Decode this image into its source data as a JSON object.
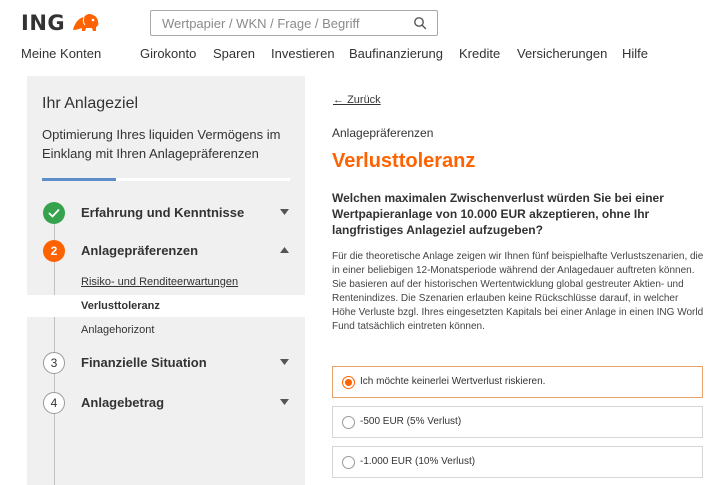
{
  "header": {
    "logo_text": "ING",
    "logo_icon": "lion-icon",
    "search_placeholder": "Wertpapier / WKN / Frage / Begriff",
    "search_value": ""
  },
  "nav": {
    "items": [
      {
        "label": "Meine Konten"
      },
      {
        "label": "Girokonto"
      },
      {
        "label": "Sparen"
      },
      {
        "label": "Investieren"
      },
      {
        "label": "Baufinanzierung"
      },
      {
        "label": "Kredite"
      },
      {
        "label": "Versicherungen"
      },
      {
        "label": "Hilfe"
      }
    ]
  },
  "sidebar": {
    "title": "Ihr Anlageziel",
    "subtitle": "Optimierung Ihres liquiden Vermögens im Einklang mit Ihren Anlagepräferenzen",
    "progress_fraction": 0.3,
    "steps": [
      {
        "number": "",
        "label": "Erfahrung und Kenntnisse",
        "status": "done"
      },
      {
        "number": "2",
        "label": "Anlagepräferenzen",
        "status": "active"
      },
      {
        "number": "3",
        "label": "Finanzielle Situation",
        "status": "todo"
      },
      {
        "number": "4",
        "label": "Anlagebetrag",
        "status": "todo"
      }
    ],
    "substeps": [
      {
        "label": "Risiko- und Renditeerwartungen"
      },
      {
        "label": "Verlusttoleranz"
      },
      {
        "label": "Anlagehorizont"
      }
    ]
  },
  "main": {
    "back_label": "Zurück",
    "back_arrow": "←",
    "section_label": "Anlagepräferenzen",
    "headline": "Verlusttoleranz",
    "question": "Welchen maximalen Zwischenverlust würden Sie bei einer Wertpapieranlage von 10.000 EUR akzeptieren, ohne Ihr langfristiges Anlageziel aufzugeben?",
    "description": "Für die theoretische Anlage zeigen wir Ihnen fünf beispielhafte Verlustszenarien, die in einer beliebigen 12-Monatsperiode während der Anlagedauer auftreten können. Sie basieren auf der historischen Wertentwicklung global gestreuter Aktien- und Rentenindizes. Die Szenarien erlauben keine Rückschlüsse darauf, in welcher Höhe Verluste bzgl. Ihres eingesetzten Kapitals bei einer Anlage in einen ING World Fund tatsächlich eintreten können.",
    "options": [
      {
        "label": "Ich möchte keinerlei Wertverlust riskieren.",
        "selected": true
      },
      {
        "label": "-500 EUR (5% Verlust)",
        "selected": false
      },
      {
        "label": "-1.000 EUR (10% Verlust)",
        "selected": false
      }
    ]
  },
  "colors": {
    "accent": "#ff6200",
    "done": "#35a24c",
    "progress": "#5e8ec9",
    "sidebar_bg": "#f0f0f0"
  }
}
